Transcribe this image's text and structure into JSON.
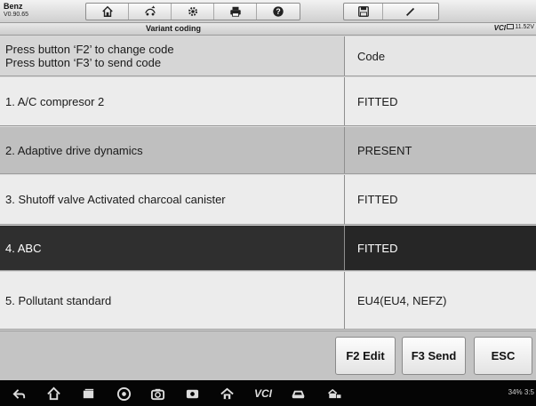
{
  "brand": {
    "name": "Benz",
    "version": "V0.90.65"
  },
  "toolbar": {
    "icons": [
      "home-icon",
      "vehicle-swap-icon",
      "settings-icon",
      "print-icon",
      "help-icon",
      "save-icon",
      "edit-icon"
    ]
  },
  "subheader": {
    "title": "Variant coding",
    "vci": "VCI",
    "voltage": "11.52V"
  },
  "table": {
    "header": {
      "line1": "Press button ‘F2’ to change code",
      "line2": "Press button ‘F3’ to send code",
      "value": "Code"
    },
    "rows": [
      {
        "label": "1. A/C compresor 2",
        "value": "FITTED"
      },
      {
        "label": "2. Adaptive drive dynamics",
        "value": "PRESENT"
      },
      {
        "label": "3. Shutoff valve Activated charcoal canister",
        "value": "FITTED"
      },
      {
        "label": "4. ABC",
        "value": "FITTED"
      },
      {
        "label": "5. Pollutant standard",
        "value": "EU4(EU4, NEFZ)"
      }
    ]
  },
  "buttons": {
    "f2": "F2 Edit",
    "f3": "F3 Send",
    "esc": "ESC"
  },
  "navbar": {
    "icons": [
      "back-icon",
      "home-icon",
      "recents-icon",
      "browser-icon",
      "camera-icon",
      "screen-record-icon",
      "maxisys-icon",
      "vci-icon",
      "car-icon",
      "shop-icon"
    ],
    "vci_label": "VCI",
    "status": "34% 3:5"
  },
  "colors": {
    "selected_row": "#2f2f2f",
    "mid_row": "#bfbfbf",
    "light_row": "#ececec"
  }
}
